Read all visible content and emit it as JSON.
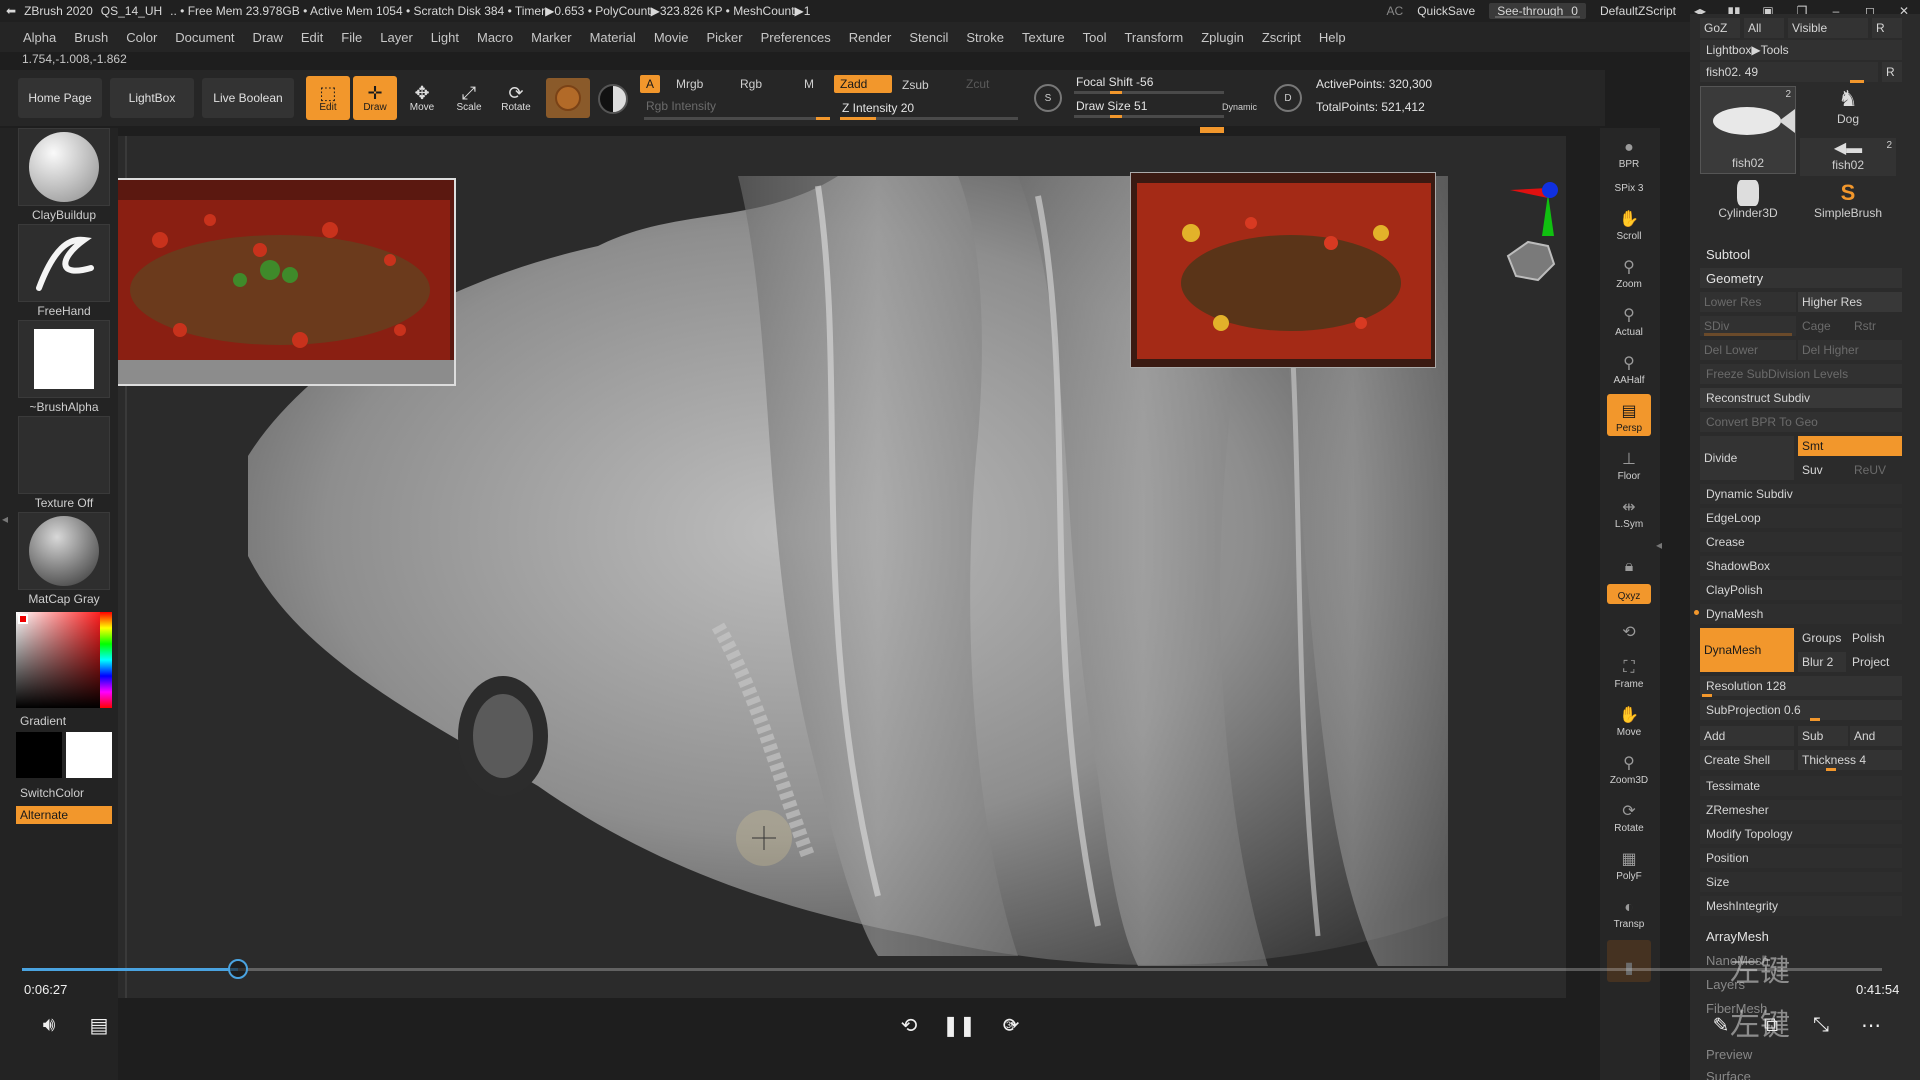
{
  "titlebar": {
    "app": "ZBrush 2020",
    "document": "QS_14_UH",
    "stats": ".. • Free Mem 23.978GB • Active Mem 1054 • Scratch Disk 384 • Timer▶0.653 • PolyCount▶323.826 KP • MeshCount▶1",
    "ac": "AC",
    "quicksave": "QuickSave",
    "see_through_label": "See-through",
    "see_through_value": "0",
    "script": "DefaultZScript"
  },
  "menu": [
    "Alpha",
    "Brush",
    "Color",
    "Document",
    "Draw",
    "Edit",
    "File",
    "Layer",
    "Light",
    "Macro",
    "Marker",
    "Material",
    "Movie",
    "Picker",
    "Preferences",
    "Render",
    "Stencil",
    "Stroke",
    "Texture",
    "Tool",
    "Transform",
    "Zplugin",
    "Zscript",
    "Help"
  ],
  "coords": "1.754,-1.008,-1.862",
  "shelf": {
    "home": "Home Page",
    "lightbox": "LightBox",
    "live_boolean": "Live Boolean",
    "tools": [
      {
        "label": "Edit",
        "icon": "edit-icon",
        "active": true
      },
      {
        "label": "Draw",
        "icon": "draw-icon",
        "active": true
      },
      {
        "label": "Move",
        "icon": "move-icon",
        "active": false
      },
      {
        "label": "Scale",
        "icon": "scale-icon",
        "active": false
      },
      {
        "label": "Rotate",
        "icon": "rotate-icon",
        "active": false
      }
    ],
    "a": "A",
    "mrgb": "Mrgb",
    "rgb": "Rgb",
    "m": "M",
    "rgb_intensity": "Rgb Intensity",
    "zadd": "Zadd",
    "zsub": "Zsub",
    "zcut": "Zcut",
    "z_intensity": "Z Intensity 20",
    "z_intensity_value": 20,
    "focal_shift": "Focal Shift -56",
    "draw_size": "Draw Size 51",
    "dynamic": "Dynamic",
    "active_points": "ActivePoints: 320,300",
    "total_points": "TotalPoints: 521,412"
  },
  "left": {
    "brush": "ClayBuildup",
    "stroke": "FreeHand",
    "alpha": "~BrushAlpha",
    "texture": "Texture Off",
    "material": "MatCap Gray",
    "gradient": "Gradient",
    "switch": "SwitchColor",
    "alternate": "Alternate"
  },
  "rightstrip": [
    {
      "label": "BPR",
      "icon": "bpr-icon"
    },
    {
      "label": "SPix 3",
      "icon": ""
    },
    {
      "label": "Scroll",
      "icon": "scroll-icon"
    },
    {
      "label": "Zoom",
      "icon": "zoom-icon"
    },
    {
      "label": "Actual",
      "icon": "actual-icon"
    },
    {
      "label": "AAHalf",
      "icon": "aahalf-icon"
    },
    {
      "label": "Persp",
      "icon": "persp-icon",
      "active": true
    },
    {
      "label": "Floor",
      "icon": "floor-icon"
    },
    {
      "label": "L.Sym",
      "icon": "lsym-icon"
    },
    {
      "label": "",
      "icon": "lock-icon"
    },
    {
      "label": "Qxyz",
      "icon": "xyz-icon",
      "active": true
    },
    {
      "label": "Frame",
      "icon": "frame-icon"
    },
    {
      "label": "Move",
      "icon": "move-icon"
    },
    {
      "label": "Zoom3D",
      "icon": "zoom3d-icon"
    },
    {
      "label": "Rotate",
      "icon": "rotate-icon"
    },
    {
      "label": "PolyF",
      "icon": "polyf-icon"
    },
    {
      "label": "Transp",
      "icon": "transp-icon"
    }
  ],
  "rightpanel": {
    "top_row": [
      "GoZ",
      "All",
      "Visible",
      "R"
    ],
    "lightbox_tools": "Lightbox▶Tools",
    "fish_slider": "fish02. 49",
    "r": "R",
    "thumbs": [
      {
        "label": "fish02",
        "count": "2"
      },
      {
        "label": "Dog",
        "count": ""
      },
      {
        "label": "fish02",
        "count": "2"
      },
      {
        "label": "Cylinder3D",
        "count": ""
      },
      {
        "label": "SimpleBrush",
        "count": ""
      }
    ],
    "subtool": "Subtool",
    "geometry": "Geometry",
    "lower_res": "Lower Res",
    "higher_res": "Higher Res",
    "sdiv": "SDiv",
    "cage": "Cage",
    "rstr": "Rstr",
    "del_lower": "Del Lower",
    "del_higher": "Del Higher",
    "freeze": "Freeze SubDivision Levels",
    "reconstruct": "Reconstruct Subdiv",
    "convert_bpr": "Convert BPR To Geo",
    "divide": "Divide",
    "smt": "Smt",
    "suv": "Suv",
    "reuv": "ReUV",
    "dynamic_subdiv": "Dynamic Subdiv",
    "edgeloop": "EdgeLoop",
    "crease": "Crease",
    "shadowbox": "ShadowBox",
    "claypolish": "ClayPolish",
    "dynamesh_header": "DynaMesh",
    "dynamesh_btn": "DynaMesh",
    "groups": "Groups",
    "polish": "Polish",
    "blur": "Blur 2",
    "project": "Project",
    "resolution": "Resolution 128",
    "subprojection": "SubProjection 0.6",
    "add": "Add",
    "sub": "Sub",
    "and": "And",
    "create_shell": "Create Shell",
    "thickness": "Thickness 4",
    "tessimate": "Tessimate",
    "zremesher": "ZRemesher",
    "modify_topology": "Modify Topology",
    "position": "Position",
    "size": "Size",
    "meshintegrity": "MeshIntegrity",
    "arraymesh": "ArrayMesh",
    "namelist": "NanoMesh",
    "layers": "Layers",
    "fibermesh": "FiberMesh",
    "preview": "Preview",
    "surface": "Surface"
  },
  "player": {
    "current_time": "0:06:27",
    "total_time": "0:41:54",
    "progress": 0.116,
    "rewind_label": "",
    "forward_label": "30",
    "watermark": "左键"
  },
  "colors": {
    "accent": "#f2972c",
    "progress": "#4aa3e0"
  }
}
